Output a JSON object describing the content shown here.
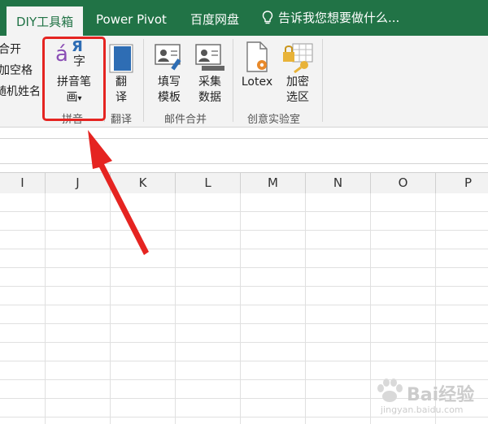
{
  "tabs": [
    {
      "label": "DIY工具箱",
      "active": true
    },
    {
      "label": "Power Pivot",
      "active": false
    },
    {
      "label": "百度网盘",
      "active": false
    },
    {
      "label": "告诉我您想要做什么...",
      "active": false
    }
  ],
  "ribbon": {
    "left_items": [
      "合开",
      "加空格",
      "随机姓名"
    ],
    "pinyin_button": {
      "line1": "拼音笔",
      "line2": "画",
      "dropdown": "▾",
      "icon_letters": {
        "accent": "á",
        "cyrillic": "Я",
        "char": "字"
      }
    },
    "translate_button": {
      "line1": "翻",
      "line2": "译"
    },
    "fill_template_button": {
      "line1": "填写",
      "line2": "模板"
    },
    "collect_data_button": {
      "line1": "采集",
      "line2": "数据"
    },
    "lotex_button": {
      "label": "Lotex"
    },
    "encrypt_button": {
      "line1": "加密",
      "line2": "选区"
    },
    "groups": [
      "拼音",
      "翻译",
      "邮件合并",
      "创意实验室"
    ]
  },
  "columns": [
    "I",
    "J",
    "K",
    "L",
    "M",
    "N",
    "O",
    "P"
  ],
  "watermark": {
    "text": "Bai经验",
    "url": "jingyan.baidu.com"
  },
  "colors": {
    "excel_green": "#217346",
    "highlight_red": "#e52421"
  }
}
